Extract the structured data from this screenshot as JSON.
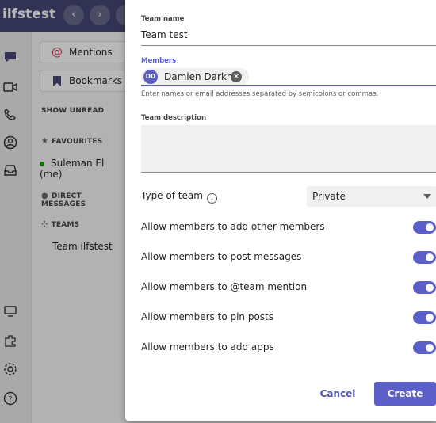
{
  "app": {
    "title": "ilfstest",
    "nav_back": "‹",
    "nav_forward": "›",
    "chips": [
      {
        "label": "Mentions",
        "icon": "at-icon"
      },
      {
        "label": "Bookmarks",
        "icon": "bookmark-icon"
      }
    ],
    "show_unread": "SHOW UNREAD",
    "favourites": "FAVOURITES",
    "favourite_user": "Suleman El (me)",
    "direct_messages": "DIRECT MESSAGES",
    "teams": "TEAMS",
    "team_item": "Team ilfstest"
  },
  "modal": {
    "team_name_label": "Team name",
    "team_name_value": "Team test",
    "members_label": "Members",
    "member": {
      "initials": "DD",
      "name": "Damien Darkh"
    },
    "members_hint": "Enter names or email addresses separated by semicolons or commas.",
    "description_label": "Team description",
    "description_value": "",
    "type_label": "Type of team",
    "type_value": "Private",
    "permissions": [
      {
        "label": "Allow members to add other members",
        "enabled": true
      },
      {
        "label": "Allow members to post messages",
        "enabled": true
      },
      {
        "label": "Allow members to @team mention",
        "enabled": true
      },
      {
        "label": "Allow members to pin posts",
        "enabled": true
      },
      {
        "label": "Allow members to add apps",
        "enabled": true
      }
    ],
    "cancel_label": "Cancel",
    "create_label": "Create"
  },
  "colors": {
    "accent": "#5b5fc7",
    "topbar": "#464775",
    "online": "#13a10e"
  }
}
